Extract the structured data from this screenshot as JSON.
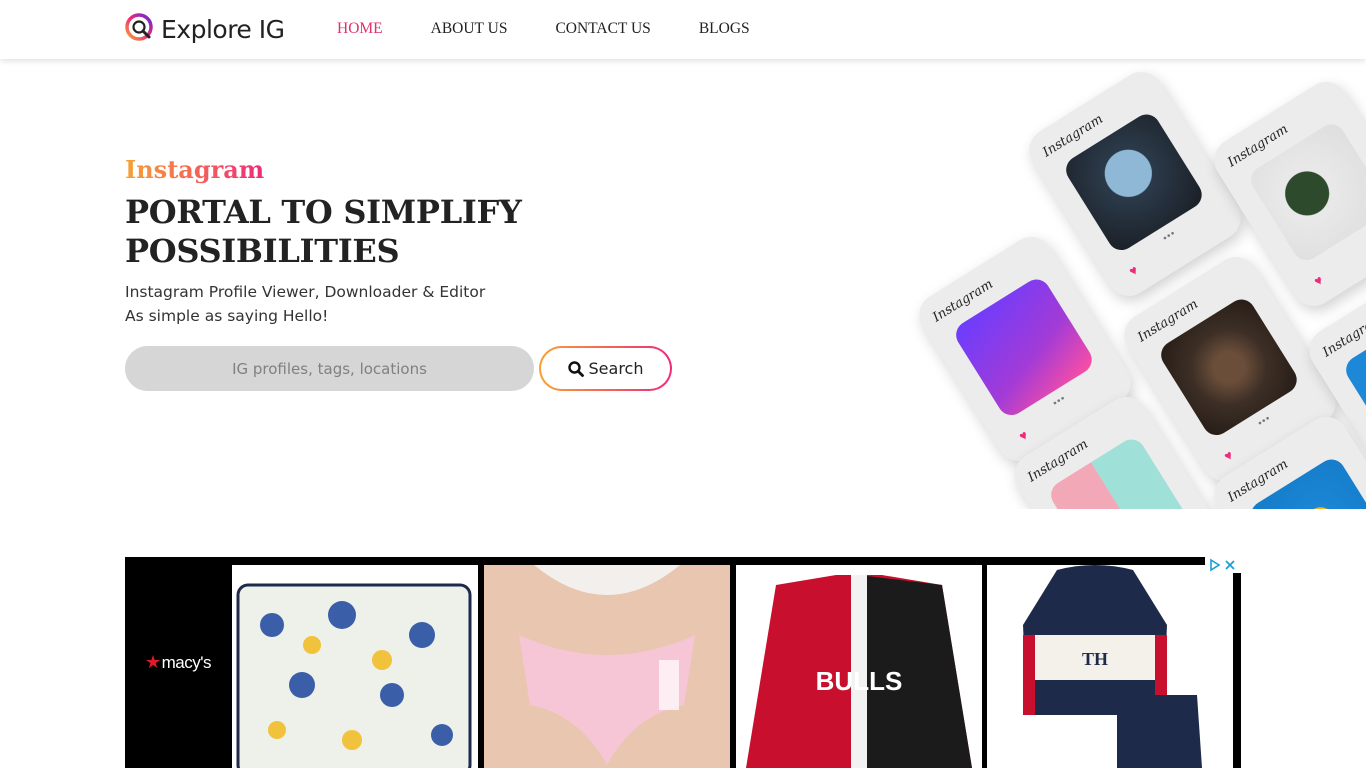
{
  "header": {
    "logo_text": "Explore IG",
    "nav": [
      {
        "label": "HOME",
        "active": true
      },
      {
        "label": "ABOUT US",
        "active": false
      },
      {
        "label": "CONTACT US",
        "active": false
      },
      {
        "label": "BLOGS",
        "active": false
      }
    ]
  },
  "hero": {
    "kicker": "Instagram",
    "title": "PORTAL TO SIMPLIFY POSSIBILITIES",
    "subtitle_line1": "Instagram Profile Viewer, Downloader & Editor",
    "subtitle_line2": "As simple as saying Hello!",
    "search_placeholder": "IG profiles, tags, locations",
    "search_button": "Search",
    "card_label": "Instagram"
  },
  "ad": {
    "brand": "macy's",
    "choices_icon": "adchoices-icon",
    "products": [
      "floral-pillow",
      "pink-brief",
      "bulls-jacket",
      "kids-hoodie-set"
    ]
  },
  "colors": {
    "accent_pink": "#ee2a7b",
    "accent_orange": "#f7a234",
    "active_nav": "#e1306c"
  }
}
